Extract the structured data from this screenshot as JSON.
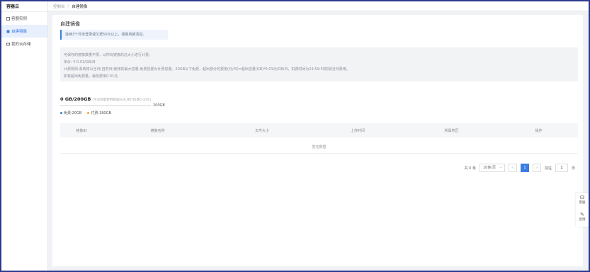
{
  "sidebar": {
    "logo": "容器云",
    "items": [
      {
        "label": "容器实例"
      },
      {
        "label": "自建镜像"
      },
      {
        "label": "我的云存储"
      }
    ]
  },
  "breadcrumb": {
    "home": "控制台",
    "sep": "/",
    "current": "自建镜像"
  },
  "page": {
    "title": "自建镜像",
    "notice": "连续3个月未登录或欠费50元以上，镜像将被清空。",
    "info_lines": [
      "可保存的镜像数量不限，以所有镜像的总大小进行计费。",
      "单价: ¥ 0.01/GB/日",
      "计费规则:系统将以当日(自然日)使用的最大容量-免费容量为计费容量。20GB以下免费，超出部分的费用(元/日)=超出容量(GB)*0.01元/GB/日，扣费时间为23:59:59扣除当日费用。",
      "如有超出免费量，最低费用0.01元"
    ]
  },
  "usage": {
    "title": "0 GB/200GB",
    "sub": "(今日容量使用峰值0GB,预计扣费0.00元)",
    "max_label": "200GB",
    "fraction": 0,
    "legend_free": "免费:20GB",
    "legend_paid": "付费:180GB",
    "colors": {
      "free": "#3a7ee4",
      "paid": "#f5a623"
    }
  },
  "table": {
    "columns": [
      "镜像ID",
      "镜像名称",
      "文件大小",
      "上传时间",
      "所属地区",
      "操作"
    ],
    "empty_text": "暂无数据"
  },
  "pager": {
    "total": "共 0 条",
    "page_size": "10条/页",
    "prev": "<",
    "current": "1",
    "next": ">",
    "goto_label": "前往",
    "goto_value": "1",
    "page_unit": "页"
  },
  "float": {
    "service": "客服",
    "feedback": "反馈"
  }
}
